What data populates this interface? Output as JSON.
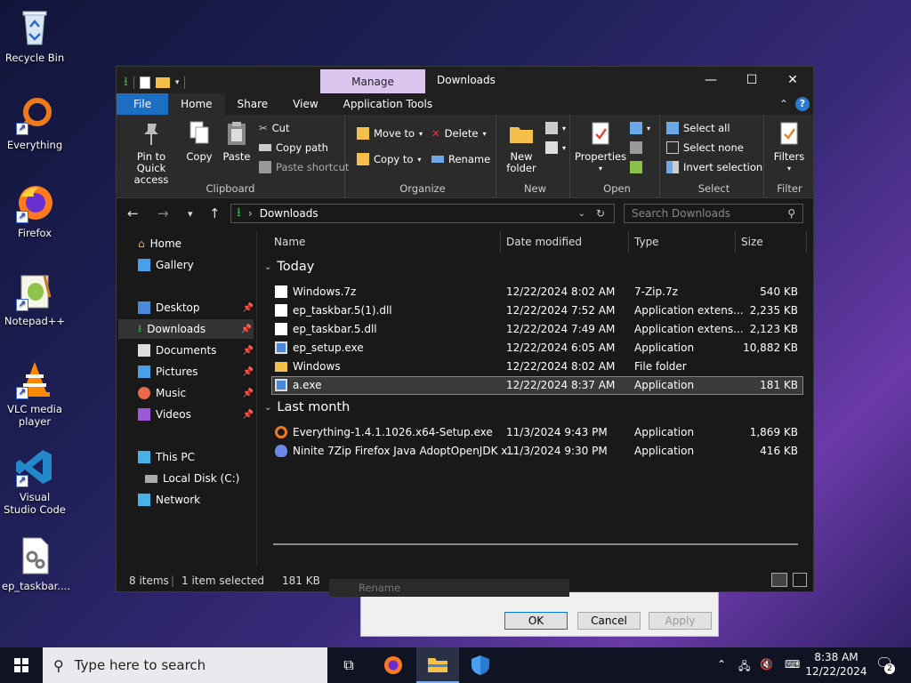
{
  "desktop": {
    "icons": [
      {
        "label": "Recycle Bin"
      },
      {
        "label": "Everything"
      },
      {
        "label": "Firefox"
      },
      {
        "label": "Notepad++"
      },
      {
        "label": "VLC media player"
      },
      {
        "label": "Visual Studio Code"
      },
      {
        "label": "ep_taskbar...."
      }
    ]
  },
  "window": {
    "manage_tab": "Manage",
    "title": "Downloads",
    "tabs": {
      "file": "File",
      "home": "Home",
      "share": "Share",
      "view": "View",
      "app_tools": "Application Tools"
    },
    "help": "?",
    "ribbon": {
      "clipboard": {
        "pin": "Pin to Quick access",
        "copy": "Copy",
        "paste": "Paste",
        "cut": "Cut",
        "copy_path": "Copy path",
        "paste_shortcut": "Paste shortcut",
        "label": "Clipboard"
      },
      "organize": {
        "move_to": "Move to",
        "copy_to": "Copy to",
        "delete": "Delete",
        "rename": "Rename",
        "label": "Organize"
      },
      "new": {
        "new_folder": "New folder",
        "label": "New"
      },
      "open": {
        "properties": "Properties",
        "label": "Open"
      },
      "select": {
        "select_all": "Select all",
        "select_none": "Select none",
        "invert": "Invert selection",
        "label": "Select"
      },
      "filter": {
        "filters": "Filters",
        "label": "Filter"
      }
    },
    "address": {
      "path": "Downloads",
      "search_placeholder": "Search Downloads"
    },
    "nav": {
      "home": "Home",
      "gallery": "Gallery",
      "desktop": "Desktop",
      "downloads": "Downloads",
      "documents": "Documents",
      "pictures": "Pictures",
      "music": "Music",
      "videos": "Videos",
      "this_pc": "This PC",
      "local_disk": "Local Disk (C:)",
      "network": "Network"
    },
    "columns": {
      "name": "Name",
      "date": "Date modified",
      "type": "Type",
      "size": "Size"
    },
    "groups": {
      "today": "Today",
      "last_month": "Last month"
    },
    "files_today": [
      {
        "name": "Windows.7z",
        "date": "12/22/2024 8:02 AM",
        "type": "7-Zip.7z",
        "size": "540 KB"
      },
      {
        "name": "ep_taskbar.5(1).dll",
        "date": "12/22/2024 7:52 AM",
        "type": "Application extens...",
        "size": "2,235 KB"
      },
      {
        "name": "ep_taskbar.5.dll",
        "date": "12/22/2024 7:49 AM",
        "type": "Application extens...",
        "size": "2,123 KB"
      },
      {
        "name": "ep_setup.exe",
        "date": "12/22/2024 6:05 AM",
        "type": "Application",
        "size": "10,882 KB"
      },
      {
        "name": "Windows",
        "date": "12/22/2024 8:02 AM",
        "type": "File folder",
        "size": ""
      },
      {
        "name": "a.exe",
        "date": "12/22/2024 8:37 AM",
        "type": "Application",
        "size": "181 KB"
      }
    ],
    "files_last_month": [
      {
        "name": "Everything-1.4.1.1026.x64-Setup.exe",
        "date": "11/3/2024 9:43 PM",
        "type": "Application",
        "size": "1,869 KB"
      },
      {
        "name": "Ninite 7Zip Firefox Java AdoptOpenJDK x...",
        "date": "11/3/2024 9:30 PM",
        "type": "Application",
        "size": "416 KB"
      }
    ],
    "status": {
      "items": "8 items",
      "selected": "1 item selected",
      "size": "181 KB"
    }
  },
  "dialog": {
    "rename_ghost": "Rename",
    "ok": "OK",
    "cancel": "Cancel",
    "apply": "Apply"
  },
  "taskbar": {
    "search_placeholder": "Type here to search",
    "time": "8:38 AM",
    "date": "12/22/2024",
    "notifications": "2"
  },
  "colors": {
    "accent": "#1b6ec2",
    "manage": "#dcc6f0",
    "window_bg": "#191919"
  }
}
